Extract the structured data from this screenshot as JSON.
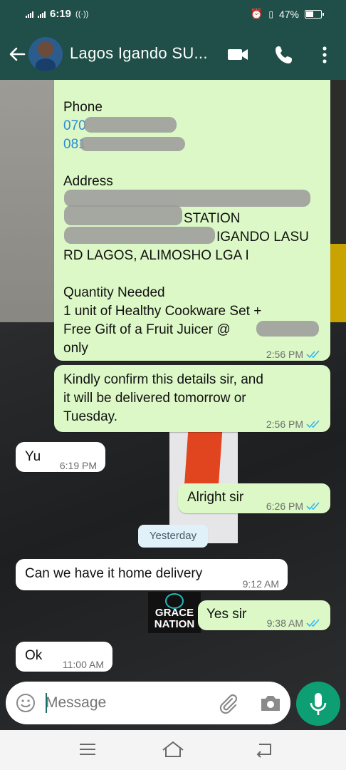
{
  "status_bar": {
    "time": "6:19",
    "battery": "47%"
  },
  "chat": {
    "title": "Lagos Igando SU..."
  },
  "messages": {
    "m1": {
      "phone_label": "Phone",
      "phone_1": "070",
      "phone_2": "081",
      "address_label": "Address",
      "address_line_2": "STATION",
      "address_line_3": "IGANDO LASU",
      "address_line_4": "RD LAGOS, ALIMOSHO LGA I",
      "quantity_label": "Quantity Needed",
      "quantity_line_1": "1 unit of Healthy Cookware Set +",
      "quantity_line_2": "Free Gift of a Fruit Juicer @",
      "quantity_line_3": "only",
      "time": "2:56 PM"
    },
    "m2": {
      "line_1": "Kindly confirm this details sir, and",
      "line_2": "it will be delivered tomorrow or",
      "line_3": "Tuesday.",
      "time": "2:56 PM"
    },
    "m3": {
      "text": "Yu",
      "time": "6:19 PM"
    },
    "m4": {
      "text": "Alright sir",
      "time": "6:26 PM"
    },
    "date_divider": "Yesterday",
    "m5": {
      "text": "Can we have it home delivery",
      "time": "9:12 AM"
    },
    "m6": {
      "text": "Yes sir",
      "time": "9:38 AM"
    },
    "m7": {
      "text": "Ok",
      "time": "11:00 AM"
    }
  },
  "wallpaper": {
    "logo_line_1": "GRACE",
    "logo_line_2": "NATION"
  },
  "composer": {
    "placeholder": "Message"
  },
  "colors": {
    "header": "#1f4f48",
    "outgoing": "#dcf8c6",
    "incoming": "#ffffff",
    "tick_blue": "#34b7f1",
    "mic": "#0e9e73"
  }
}
